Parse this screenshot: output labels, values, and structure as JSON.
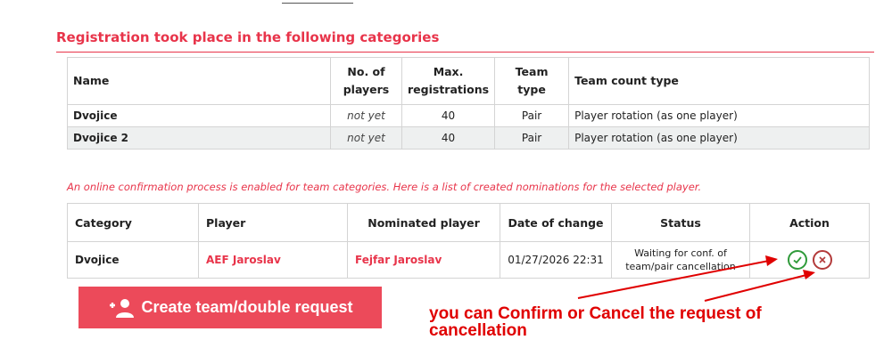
{
  "section_title": "Registration took place in the following categories",
  "categories_table": {
    "headers": {
      "name": "Name",
      "players_l1": "No. of",
      "players_l2": "players",
      "max_l1": "Max.",
      "max_l2": "registrations",
      "team_type": "Team type",
      "count_type": "Team count type"
    },
    "rows": [
      {
        "name": "Dvojice",
        "players": "not yet",
        "max": "40",
        "team_type": "Pair",
        "count_type": "Player rotation (as one player)"
      },
      {
        "name": "Dvojice 2",
        "players": "not yet",
        "max": "40",
        "team_type": "Pair",
        "count_type": "Player rotation (as one player)"
      }
    ]
  },
  "info_note": "An online confirmation process is enabled for team categories. Here is a list of created nominations for the selected player.",
  "nominations_table": {
    "headers": {
      "category": "Category",
      "player": "Player",
      "nominated": "Nominated player",
      "date": "Date of change",
      "status": "Status",
      "action": "Action"
    },
    "rows": [
      {
        "category": "Dvojice",
        "player": "AEF Jaroslav",
        "nominated": "Fejfar Jaroslav",
        "date": "01/27/2026 22:31",
        "status_l1": "Waiting for conf. of",
        "status_l2": "team/pair cancellation",
        "confirm_icon": "check-circle-icon",
        "cancel_icon": "x-circle-icon"
      }
    ]
  },
  "create_button": {
    "label": "Create team/double request",
    "icon": "add-user-icon"
  },
  "annotation": {
    "line1": "you can Confirm or Cancel the request of",
    "line2": "cancellation"
  },
  "colors": {
    "accent": "#e8344a",
    "button": "#ec4a5a",
    "confirm": "#2f9a3a",
    "cancel": "#b33a3a",
    "annotation": "#e00000"
  }
}
